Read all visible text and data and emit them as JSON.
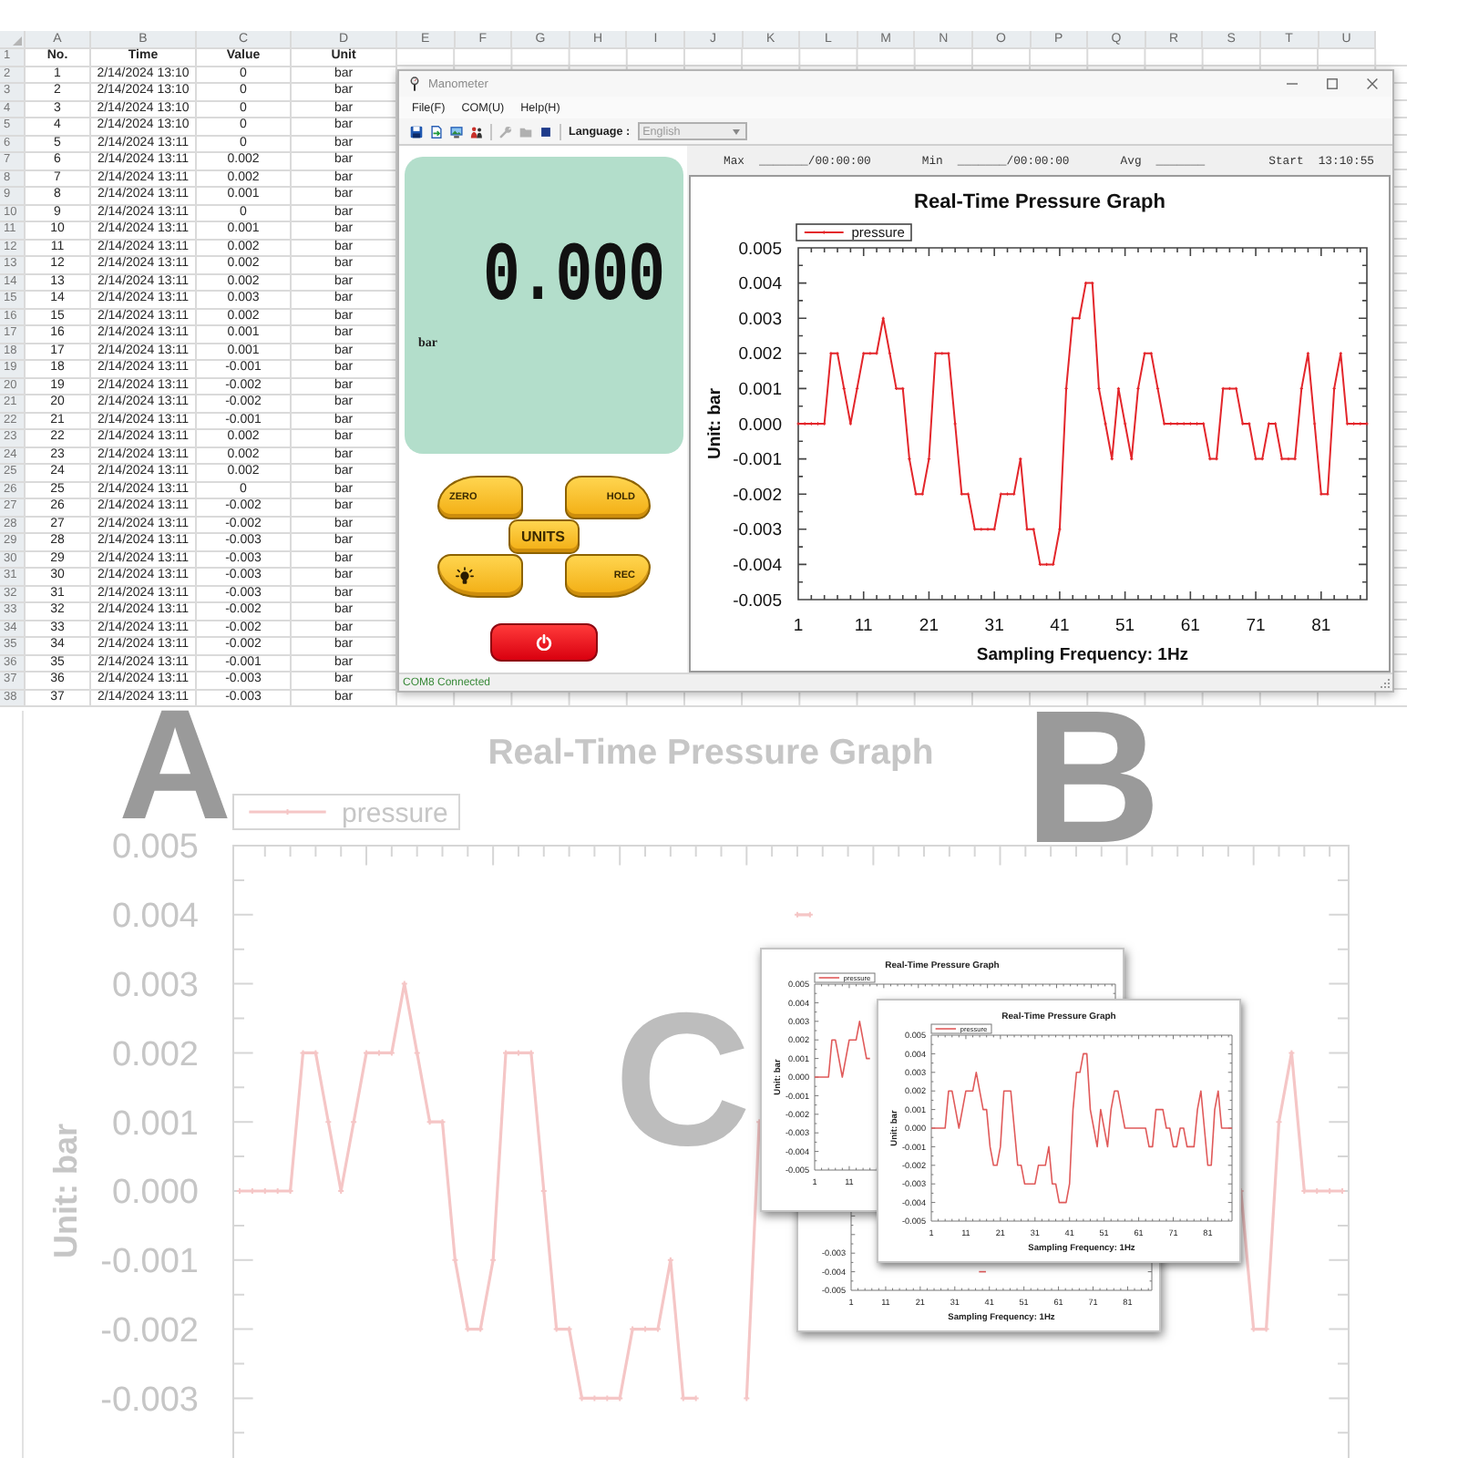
{
  "spreadsheet": {
    "column_letters": [
      "A",
      "B",
      "C",
      "D",
      "E",
      "F",
      "G",
      "H",
      "I",
      "J",
      "K",
      "L",
      "M",
      "N",
      "O",
      "P",
      "Q",
      "R",
      "S",
      "T",
      "U"
    ],
    "header_row": {
      "row": "1",
      "cells": [
        "No.",
        "Time",
        "Value",
        "Unit"
      ]
    },
    "rows": [
      {
        "row": "2",
        "cells": [
          "1",
          "2/14/2024 13:10",
          "0",
          "bar"
        ]
      },
      {
        "row": "3",
        "cells": [
          "2",
          "2/14/2024 13:10",
          "0",
          "bar"
        ]
      },
      {
        "row": "4",
        "cells": [
          "3",
          "2/14/2024 13:10",
          "0",
          "bar"
        ]
      },
      {
        "row": "5",
        "cells": [
          "4",
          "2/14/2024 13:10",
          "0",
          "bar"
        ]
      },
      {
        "row": "6",
        "cells": [
          "5",
          "2/14/2024 13:11",
          "0",
          "bar"
        ]
      },
      {
        "row": "7",
        "cells": [
          "6",
          "2/14/2024 13:11",
          "0.002",
          "bar"
        ]
      },
      {
        "row": "8",
        "cells": [
          "7",
          "2/14/2024 13:11",
          "0.002",
          "bar"
        ]
      },
      {
        "row": "9",
        "cells": [
          "8",
          "2/14/2024 13:11",
          "0.001",
          "bar"
        ]
      },
      {
        "row": "10",
        "cells": [
          "9",
          "2/14/2024 13:11",
          "0",
          "bar"
        ]
      },
      {
        "row": "11",
        "cells": [
          "10",
          "2/14/2024 13:11",
          "0.001",
          "bar"
        ]
      },
      {
        "row": "12",
        "cells": [
          "11",
          "2/14/2024 13:11",
          "0.002",
          "bar"
        ]
      },
      {
        "row": "13",
        "cells": [
          "12",
          "2/14/2024 13:11",
          "0.002",
          "bar"
        ]
      },
      {
        "row": "14",
        "cells": [
          "13",
          "2/14/2024 13:11",
          "0.002",
          "bar"
        ]
      },
      {
        "row": "15",
        "cells": [
          "14",
          "2/14/2024 13:11",
          "0.003",
          "bar"
        ]
      },
      {
        "row": "16",
        "cells": [
          "15",
          "2/14/2024 13:11",
          "0.002",
          "bar"
        ]
      },
      {
        "row": "17",
        "cells": [
          "16",
          "2/14/2024 13:11",
          "0.001",
          "bar"
        ]
      },
      {
        "row": "18",
        "cells": [
          "17",
          "2/14/2024 13:11",
          "0.001",
          "bar"
        ]
      },
      {
        "row": "19",
        "cells": [
          "18",
          "2/14/2024 13:11",
          "-0.001",
          "bar"
        ]
      },
      {
        "row": "20",
        "cells": [
          "19",
          "2/14/2024 13:11",
          "-0.002",
          "bar"
        ]
      },
      {
        "row": "21",
        "cells": [
          "20",
          "2/14/2024 13:11",
          "-0.002",
          "bar"
        ]
      },
      {
        "row": "22",
        "cells": [
          "21",
          "2/14/2024 13:11",
          "-0.001",
          "bar"
        ]
      },
      {
        "row": "23",
        "cells": [
          "22",
          "2/14/2024 13:11",
          "0.002",
          "bar"
        ]
      },
      {
        "row": "24",
        "cells": [
          "23",
          "2/14/2024 13:11",
          "0.002",
          "bar"
        ]
      },
      {
        "row": "25",
        "cells": [
          "24",
          "2/14/2024 13:11",
          "0.002",
          "bar"
        ]
      },
      {
        "row": "26",
        "cells": [
          "25",
          "2/14/2024 13:11",
          "0",
          "bar"
        ]
      },
      {
        "row": "27",
        "cells": [
          "26",
          "2/14/2024 13:11",
          "-0.002",
          "bar"
        ]
      },
      {
        "row": "28",
        "cells": [
          "27",
          "2/14/2024 13:11",
          "-0.002",
          "bar"
        ]
      },
      {
        "row": "29",
        "cells": [
          "28",
          "2/14/2024 13:11",
          "-0.003",
          "bar"
        ]
      },
      {
        "row": "30",
        "cells": [
          "29",
          "2/14/2024 13:11",
          "-0.003",
          "bar"
        ]
      },
      {
        "row": "31",
        "cells": [
          "30",
          "2/14/2024 13:11",
          "-0.003",
          "bar"
        ]
      },
      {
        "row": "32",
        "cells": [
          "31",
          "2/14/2024 13:11",
          "-0.003",
          "bar"
        ]
      },
      {
        "row": "33",
        "cells": [
          "32",
          "2/14/2024 13:11",
          "-0.002",
          "bar"
        ]
      },
      {
        "row": "34",
        "cells": [
          "33",
          "2/14/2024 13:11",
          "-0.002",
          "bar"
        ]
      },
      {
        "row": "35",
        "cells": [
          "34",
          "2/14/2024 13:11",
          "-0.002",
          "bar"
        ]
      },
      {
        "row": "36",
        "cells": [
          "35",
          "2/14/2024 13:11",
          "-0.001",
          "bar"
        ]
      },
      {
        "row": "37",
        "cells": [
          "36",
          "2/14/2024 13:11",
          "-0.003",
          "bar"
        ]
      },
      {
        "row": "38",
        "cells": [
          "37",
          "2/14/2024 13:11",
          "-0.003",
          "bar"
        ]
      }
    ]
  },
  "window": {
    "title": "Manometer",
    "menu": [
      "File(F)",
      "COM(U)",
      "Help(H)"
    ],
    "toolbar": {
      "button_groups": [
        [
          {
            "kind": "save",
            "disabled": false
          },
          {
            "kind": "export",
            "disabled": false
          },
          {
            "kind": "image",
            "disabled": false
          },
          {
            "kind": "people",
            "disabled": false
          }
        ],
        [
          {
            "kind": "tools",
            "disabled": true
          },
          {
            "kind": "folder",
            "disabled": true
          },
          {
            "kind": "stop",
            "disabled": false
          }
        ]
      ],
      "language_label": "Language :",
      "language": {
        "value": "English",
        "disabled": true
      }
    },
    "device": {
      "reading": "0.000",
      "unit": "bar",
      "buttons": [
        {
          "kind": "zero",
          "label": "ZERO"
        },
        {
          "kind": "hold",
          "label": "HOLD"
        },
        {
          "kind": "units",
          "label": "UNITS"
        },
        {
          "kind": "light"
        },
        {
          "kind": "rec",
          "label": "REC"
        },
        {
          "kind": "power"
        }
      ]
    },
    "stats": [
      {
        "label": "Max",
        "value": "_______/00:00:00"
      },
      {
        "label": "Min",
        "value": "_______/00:00:00"
      },
      {
        "label": "Avg",
        "value": "_______"
      },
      {
        "label": "Start",
        "value": "13:10:55"
      }
    ],
    "chart": {
      "chart_data": {
        "type": "line",
        "title": "Real-Time Pressure Graph",
        "xlabel": "Sampling Frequency: 1Hz",
        "ylabel": "Unit: bar",
        "x": [
          1,
          2,
          3,
          4,
          5,
          6,
          7,
          8,
          9,
          10,
          11,
          12,
          13,
          14,
          15,
          16,
          17,
          18,
          19,
          20,
          21,
          22,
          23,
          24,
          25,
          26,
          27,
          28,
          29,
          30,
          31,
          32,
          33,
          34,
          35,
          36,
          37,
          38,
          39,
          40,
          41,
          42,
          43,
          44,
          45,
          46,
          47,
          48,
          49,
          50,
          51,
          52,
          53,
          54,
          55,
          56,
          57,
          58,
          59,
          60,
          61,
          62,
          63,
          64,
          65,
          66,
          67,
          68,
          69,
          70,
          71,
          72,
          73,
          74,
          75,
          76,
          77,
          78,
          79,
          80,
          81,
          82,
          83,
          84,
          85,
          86,
          87,
          88
        ],
        "xlim": [
          1,
          88
        ],
        "ylim": [
          -0.005,
          0.005
        ],
        "xticks": [
          1,
          11,
          21,
          31,
          41,
          51,
          61,
          71,
          81
        ],
        "yticks": [
          0.005,
          0.004,
          0.003,
          0.002,
          0.001,
          {
            "value": 0,
            "label": "0.000"
          },
          -0.001,
          -0.002,
          -0.003,
          -0.004,
          -0.005
        ],
        "series": [
          {
            "name": "pressure",
            "color": "#e3262b",
            "values": [
              0,
              0,
              0,
              0,
              0,
              0.002,
              0.002,
              0.001,
              0,
              0.001,
              0.002,
              0.002,
              0.002,
              0.003,
              0.002,
              0.001,
              0.001,
              -0.001,
              -0.002,
              -0.002,
              -0.001,
              0.002,
              0.002,
              0.002,
              0,
              -0.002,
              -0.002,
              -0.003,
              -0.003,
              -0.003,
              -0.003,
              -0.002,
              -0.002,
              -0.002,
              -0.001,
              -0.003,
              -0.003,
              -0.004,
              -0.004,
              -0.004,
              -0.003,
              0.001,
              0.003,
              0.003,
              0.004,
              0.004,
              0.001,
              0,
              -0.001,
              0.001,
              0,
              -0.001,
              0.001,
              0.002,
              0.002,
              0.001,
              0,
              0,
              0,
              0,
              0,
              0,
              0,
              -0.001,
              -0.001,
              0.001,
              0.001,
              0.001,
              0,
              0,
              -0.001,
              -0.001,
              0,
              0,
              -0.001,
              -0.001,
              -0.001,
              0.001,
              0.002,
              0,
              -0.002,
              -0.002,
              0.001,
              0.002,
              0,
              0,
              0,
              0
            ]
          }
        ]
      }
    },
    "status": "COM8 Connected"
  },
  "panel_labels": [
    "A",
    "B",
    "C"
  ],
  "overview_chart": {
    "chart_data": {
      "type": "line",
      "title": "Real-Time Pressure Graph",
      "ylabel": "Unit: bar",
      "categories": [
        null,
        null,
        null,
        null,
        null,
        null,
        null,
        null,
        null,
        null,
        null,
        null,
        null,
        null,
        null,
        null,
        null,
        null,
        null,
        null,
        null,
        null,
        null,
        null,
        null,
        null,
        null,
        null,
        null,
        null,
        null,
        null,
        null,
        null,
        null,
        null,
        null,
        null,
        null,
        null,
        null,
        null,
        null,
        null,
        null,
        null,
        null,
        null,
        null,
        null,
        null,
        null,
        null,
        null,
        null,
        null,
        null,
        null,
        null,
        null,
        null,
        null,
        null,
        null,
        null,
        null,
        null,
        null,
        null,
        null,
        null,
        null,
        null,
        null,
        null,
        null,
        null,
        null,
        null,
        null,
        null,
        null,
        null,
        null,
        null,
        null,
        null,
        null
      ],
      "ylim": [
        -0.005,
        0.005
      ],
      "yticks": [
        0.005,
        0.004,
        0.003,
        0.002,
        0.001,
        {
          "value": 0,
          "label": "0.000"
        },
        -0.001,
        -0.002,
        -0.003
      ],
      "series": [
        {
          "name": "pressure",
          "color": "#f5c6c6",
          "values": [
            0,
            0,
            0,
            0,
            0,
            0.002,
            0.002,
            0.001,
            0,
            0.001,
            0.002,
            0.002,
            0.002,
            0.003,
            0.002,
            0.001,
            0.001,
            -0.001,
            -0.002,
            -0.002,
            -0.001,
            0.002,
            0.002,
            0.002,
            0,
            -0.002,
            -0.002,
            -0.003,
            -0.003,
            -0.003,
            -0.003,
            -0.002,
            -0.002,
            -0.002,
            -0.001,
            -0.003,
            -0.003,
            null,
            null,
            null,
            -0.003,
            0.001,
            null,
            null,
            0.004,
            0.004,
            null,
            null,
            null,
            null,
            null,
            null,
            null,
            null,
            null,
            null,
            null,
            null,
            null,
            null,
            null,
            null,
            null,
            null,
            null,
            null,
            null,
            null,
            null,
            null,
            null,
            null,
            null,
            null,
            null,
            null,
            null,
            null,
            null,
            0,
            -0.002,
            -0.002,
            0.001,
            0.002,
            0,
            0,
            0,
            0
          ]
        }
      ]
    }
  },
  "chart_cards": [
    {
      "chart_data": {
        "type": "line",
        "xlabel": "Sampling Frequency: 1Hz",
        "x": [
          38,
          39,
          40
        ],
        "xlim": [
          1,
          88
        ],
        "ylim": [
          -0.005,
          -0.003
        ],
        "xticks": [
          1,
          11,
          21,
          31,
          41,
          51,
          61,
          71,
          81
        ],
        "yticks": [
          -0.003,
          -0.004,
          -0.005
        ],
        "series": [
          {
            "color": "#e05a5a",
            "values": [
              -0.004,
              -0.004,
              -0.004
            ]
          }
        ]
      }
    },
    {
      "chart_data": {
        "type": "line",
        "title": "Real-Time Pressure Graph",
        "ylabel": "Unit: bar",
        "x": [
          1,
          2,
          3,
          4,
          5,
          6,
          7,
          8,
          9,
          10,
          11,
          12,
          13,
          14,
          15,
          16,
          17
        ],
        "xlim": [
          1,
          88
        ],
        "ylim": [
          -0.005,
          0.005
        ],
        "xticks": [
          1,
          11
        ],
        "yticks": [
          0.005,
          0.004,
          0.003,
          0.002,
          0.001,
          {
            "value": 0,
            "label": "0.000"
          },
          -0.001,
          -0.002,
          -0.003,
          -0.004,
          -0.005
        ],
        "series": [
          {
            "name": "pressure",
            "color": "#e05a5a",
            "values": [
              0,
              0,
              0,
              0,
              0,
              0.002,
              0.002,
              0.001,
              0,
              0.001,
              0.002,
              0.002,
              0.002,
              0.003,
              0.002,
              0.001,
              0.001
            ]
          }
        ]
      }
    },
    {
      "chart_data": {
        "type": "line",
        "title": "Real-Time Pressure Graph",
        "xlabel": "Sampling Frequency: 1Hz",
        "ylabel": "Unit: bar",
        "x": [
          1,
          2,
          3,
          4,
          5,
          6,
          7,
          8,
          9,
          10,
          11,
          12,
          13,
          14,
          15,
          16,
          17,
          18,
          19,
          20,
          21,
          22,
          23,
          24,
          25,
          26,
          27,
          28,
          29,
          30,
          31,
          32,
          33,
          34,
          35,
          36,
          37,
          38,
          39,
          40,
          41,
          42,
          43,
          44,
          45,
          46,
          47,
          48,
          49,
          50,
          51,
          52,
          53,
          54,
          55,
          56,
          57,
          58,
          59,
          60,
          61,
          62,
          63,
          64,
          65,
          66,
          67,
          68,
          69,
          70,
          71,
          72,
          73,
          74,
          75,
          76,
          77,
          78,
          79,
          80,
          81,
          82,
          83,
          84,
          85,
          86,
          87,
          88
        ],
        "xlim": [
          1,
          88
        ],
        "ylim": [
          -0.005,
          0.005
        ],
        "xticks": [
          1,
          11,
          21,
          31,
          41,
          51,
          61,
          71,
          81
        ],
        "yticks": [
          0.005,
          0.004,
          0.003,
          0.002,
          0.001,
          {
            "value": 0,
            "label": "0.000"
          },
          -0.001,
          -0.002,
          -0.003,
          -0.004,
          -0.005
        ],
        "series": [
          {
            "name": "pressure",
            "color": "#e05a5a",
            "values": [
              0,
              0,
              0,
              0,
              0,
              0.002,
              0.002,
              0.001,
              0,
              0.001,
              0.002,
              0.002,
              0.002,
              0.003,
              0.002,
              0.001,
              0.001,
              -0.001,
              -0.002,
              -0.002,
              -0.001,
              0.002,
              0.002,
              0.002,
              0,
              -0.002,
              -0.002,
              -0.003,
              -0.003,
              -0.003,
              -0.003,
              -0.002,
              -0.002,
              -0.002,
              -0.001,
              -0.003,
              -0.003,
              -0.004,
              -0.004,
              -0.004,
              -0.003,
              0.001,
              0.003,
              0.003,
              0.004,
              0.004,
              0.001,
              0,
              -0.001,
              0.001,
              0,
              -0.001,
              0.001,
              0.002,
              0.002,
              0.001,
              0,
              0,
              0,
              0,
              0,
              0,
              0,
              -0.001,
              -0.001,
              0.001,
              0.001,
              0.001,
              0,
              0,
              -0.001,
              -0.001,
              0,
              0,
              -0.001,
              -0.001,
              -0.001,
              0.001,
              0.002,
              0,
              -0.002,
              -0.002,
              0.001,
              0.002,
              0,
              0,
              0,
              0
            ]
          }
        ]
      }
    }
  ]
}
